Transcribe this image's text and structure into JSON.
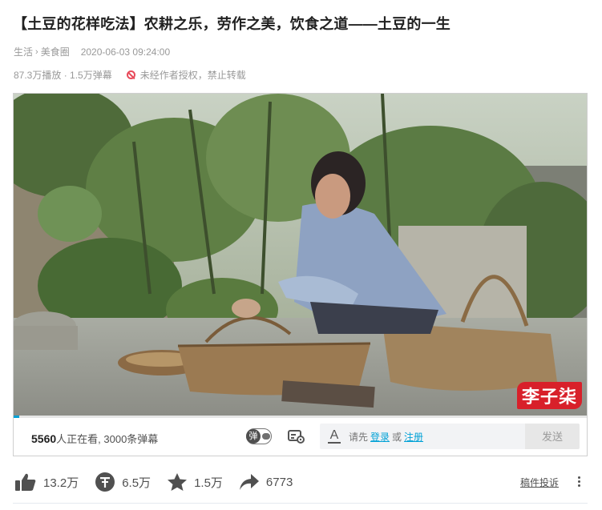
{
  "video": {
    "title": "【土豆的花样吃法】农耕之乐，劳作之美，饮食之道——土豆的一生",
    "breadcrumb": [
      "生活",
      "美食圈"
    ],
    "date": "2020-06-03 09:24:00",
    "stats": "87.3万播放 · 1.5万弹幕",
    "no_repost": "未经作者授权，禁止转载",
    "watermark": "李子柒"
  },
  "player": {
    "viewers_count": "5560",
    "viewers_text": "人正在看, 3000条弹幕",
    "toggle_label": "弹",
    "input_prefix": "请先",
    "login": "登录",
    "or": "或",
    "register": "注册",
    "send": "发送",
    "progress_percent": 1
  },
  "actions": {
    "like": "13.2万",
    "coin": "6.5万",
    "favorite": "1.5万",
    "share": "6773",
    "complaint": "稿件投诉"
  },
  "colors": {
    "accent": "#00a1d6",
    "ban_red": "#e84b5b",
    "watermark_red": "#d8202a"
  }
}
